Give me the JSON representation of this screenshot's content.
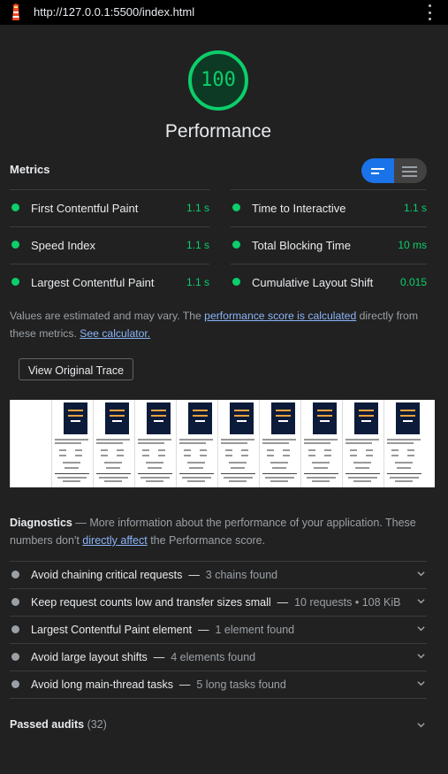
{
  "browser": {
    "url": "http://127.0.0.1:5500/index.html",
    "menu_icon": "kebab-menu-icon",
    "logo_icon": "lighthouse-icon"
  },
  "score": {
    "value": "100",
    "fraction": 1.0,
    "title": "Performance",
    "color": "#0cce6b"
  },
  "metrics": {
    "title": "Metrics",
    "items": [
      {
        "label": "First Contentful Paint",
        "value": "1.1 s"
      },
      {
        "label": "Time to Interactive",
        "value": "1.1 s"
      },
      {
        "label": "Speed Index",
        "value": "1.1 s"
      },
      {
        "label": "Total Blocking Time",
        "value": "10 ms"
      },
      {
        "label": "Largest Contentful Paint",
        "value": "1.1 s"
      },
      {
        "label": "Cumulative Layout Shift",
        "value": "0.015"
      }
    ]
  },
  "note": {
    "pre": "Values are estimated and may vary. The ",
    "link1": "performance score is calculated",
    "mid": " directly from these metrics. ",
    "link2": "See calculator."
  },
  "trace_button": "View Original Trace",
  "diagnostics": {
    "title": "Diagnostics",
    "dash": " — ",
    "desc1": "More information about the performance of your application. These numbers don't ",
    "link": "directly affect",
    "desc2": " the Performance score.",
    "audits": [
      {
        "label": "Avoid chaining critical requests",
        "summary": "3 chains found"
      },
      {
        "label": "Keep request counts low and transfer sizes small",
        "summary": "10 requests • 108 KiB"
      },
      {
        "label": "Largest Contentful Paint element",
        "summary": "1 element found"
      },
      {
        "label": "Avoid large layout shifts",
        "summary": "4 elements found"
      },
      {
        "label": "Avoid long main-thread tasks",
        "summary": "5 long tasks found"
      }
    ]
  },
  "passed": {
    "label": "Passed audits",
    "count": "(32)"
  },
  "colors": {
    "pass": "#0cce6b",
    "accent": "#1a73e8",
    "link": "#8ab4f8",
    "neutral": "#9aa0a6"
  }
}
